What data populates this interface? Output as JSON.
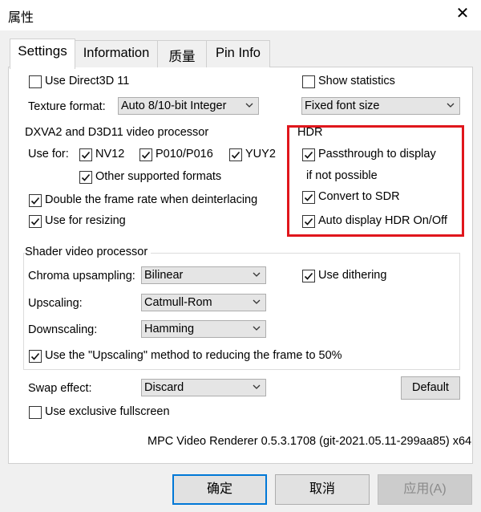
{
  "window": {
    "title": "属性",
    "close_glyph": "✕"
  },
  "tabs": [
    "Settings",
    "Information",
    "质量",
    "Pin Info"
  ],
  "settings": {
    "use_d3d11": "Use Direct3D 11",
    "show_statistics": "Show statistics",
    "texture_format_label": "Texture format:",
    "texture_format_value": "Auto 8/10-bit Integer",
    "font_value": "Fixed font size",
    "dxva_group_title": "DXVA2 and D3D11 video processor",
    "use_for_label": "Use for:",
    "nv12": "NV12",
    "p010": "P010/P016",
    "yuy2": "YUY2",
    "other_formats": "Other supported formats",
    "double_frame_rate": "Double the frame rate when deinterlacing",
    "use_for_resizing": "Use for resizing",
    "hdr_title": "HDR",
    "passthrough": "Passthrough to display",
    "if_not_possible": "if not possible",
    "convert_sdr": "Convert to SDR",
    "auto_hdr": "Auto display HDR On/Off",
    "shader_group_title": "Shader video processor",
    "chroma_label": "Chroma upsampling:",
    "chroma_value": "Bilinear",
    "use_dithering": "Use dithering",
    "upscaling_label": "Upscaling:",
    "upscaling_value": "Catmull-Rom",
    "downscaling_label": "Downscaling:",
    "downscaling_value": "Hamming",
    "upscaling_method": "Use the \"Upscaling\" method to reducing the frame to 50%",
    "swap_label": "Swap effect:",
    "swap_value": "Discard",
    "default_button": "Default",
    "exclusive_fullscreen": "Use exclusive fullscreen",
    "version": "MPC Video Renderer 0.5.3.1708 (git-2021.05.11-299aa85) x64"
  },
  "checked": {
    "use_d3d11": false,
    "show_statistics": false,
    "nv12": true,
    "p010": true,
    "yuy2": true,
    "other_formats": true,
    "double_frame_rate": true,
    "use_for_resizing": true,
    "passthrough": true,
    "convert_sdr": true,
    "auto_hdr": true,
    "use_dithering": true,
    "upscaling_method": true,
    "exclusive_fullscreen": false
  },
  "buttons": {
    "ok": "确定",
    "cancel": "取消",
    "apply": "应用(A)"
  },
  "colors": {
    "highlight_box": "#e0161c",
    "default_button_border": "#0078d7"
  },
  "icons": {
    "close": "close-icon",
    "dropdown": "chevron-down-icon",
    "check": "checkmark-icon"
  }
}
